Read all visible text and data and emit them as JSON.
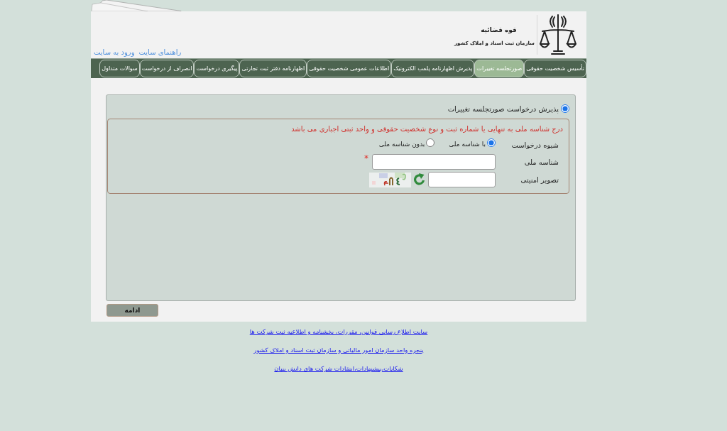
{
  "header": {
    "links": [
      {
        "label": "راهنمای سایت"
      },
      {
        "label": "ورود به سایت"
      }
    ],
    "logo": {
      "title": "قوه قضائیه",
      "subtitle": "سازمان ثبت اسناد و املاک کشور"
    }
  },
  "nav": {
    "tabs": [
      {
        "label": "تأسیس شخصیت حقوقی",
        "selected": false
      },
      {
        "label": "صورتجلسه تغییرات",
        "selected": true
      },
      {
        "label": "پذیرش اظهارنامه پلمب الکترونیک",
        "selected": false
      },
      {
        "label": "اطلاعات عمومی شخصیت حقوقی",
        "selected": false
      },
      {
        "label": "اظهارنامه دفتر ثبت تجارتی",
        "selected": false
      },
      {
        "label": "پیگیری درخواست",
        "selected": false
      },
      {
        "label": "انصراف از درخواست",
        "selected": false
      },
      {
        "label": "سوالات متداول",
        "selected": false
      }
    ]
  },
  "form": {
    "option": {
      "label": "پذیرش درخواست صورتجلسه تغییرات",
      "checked": true
    },
    "notice": "درج شناسه ملی به تنهایی یا شماره ثبت و نوع شخصیت حقوقی و واحد ثبتی اجباری می باشد",
    "fields": [
      {
        "kind": "radio",
        "label": "شیوه درخواست",
        "options": [
          {
            "label": "با شناسه ملی",
            "selected": true
          },
          {
            "label": "بدون شناسه ملی",
            "selected": false
          }
        ]
      },
      {
        "kind": "text",
        "label": "شناسه ملی",
        "required_mark": "*"
      },
      {
        "kind": "captcha",
        "label": "تصویر امنیتی"
      }
    ]
  },
  "button": {
    "label": "ادامه"
  },
  "footer": {
    "links": [
      {
        "label": "سایت اطلاع رسانی قوانین، مقررات، بخشنامه و اطلاعیه ثبت شرکت ها"
      },
      {
        "label": "پنجره واحد سازمان امور مالیاتی و سازمان ثبت اسناد و املاک کشور"
      },
      {
        "label": "شکایات،پیشنهادات،انتقادات شرکت های دانش بنیان"
      }
    ]
  }
}
